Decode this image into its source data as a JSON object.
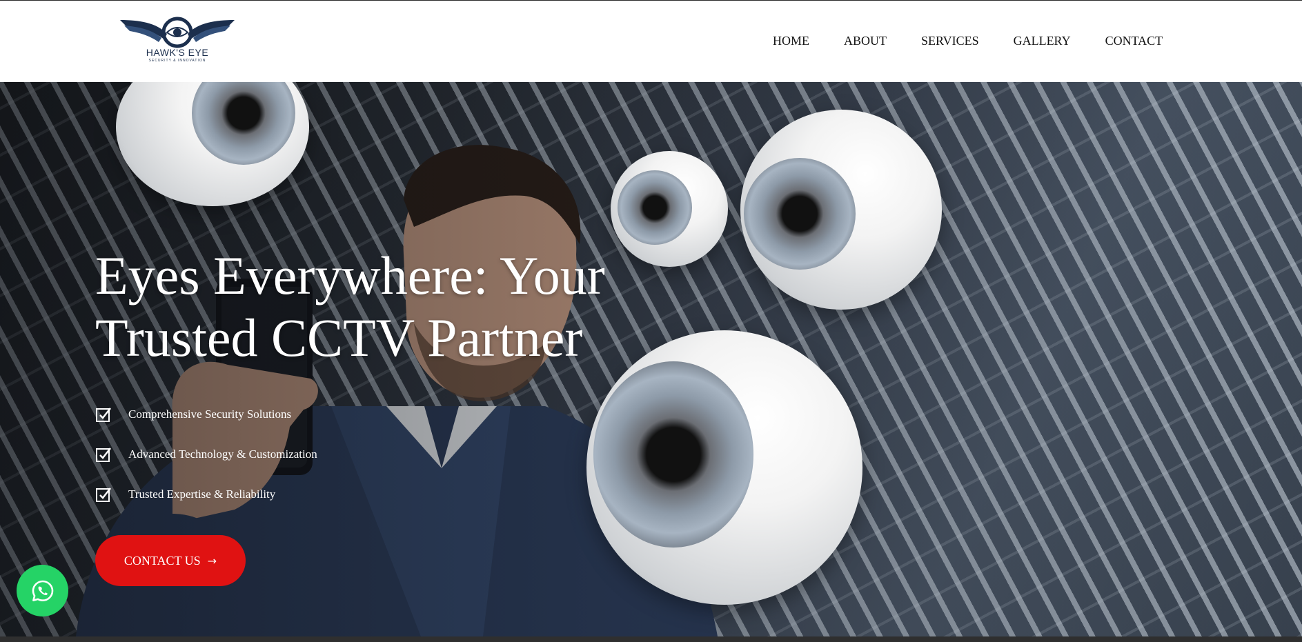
{
  "logo": {
    "title": "HAWK'S EYE",
    "tagline": "SECURITY & INNOVATION"
  },
  "nav": {
    "items": [
      "HOME",
      "ABOUT",
      "SERVICES",
      "GALLERY",
      "CONTACT"
    ]
  },
  "hero": {
    "headline_line1": "Eyes Everywhere: Your",
    "headline_line2": "Trusted CCTV Partner",
    "features": [
      "Comprehensive Security Solutions",
      "Advanced Technology & Customization",
      "Trusted Expertise & Reliability"
    ],
    "cta_label": "CONTACT US",
    "cta_icon": "arrow-right-icon"
  },
  "floating": {
    "whatsapp_icon": "whatsapp-icon"
  },
  "colors": {
    "accent": "#e01212",
    "whatsapp": "#25d366",
    "brand": "#1c2f4d"
  }
}
